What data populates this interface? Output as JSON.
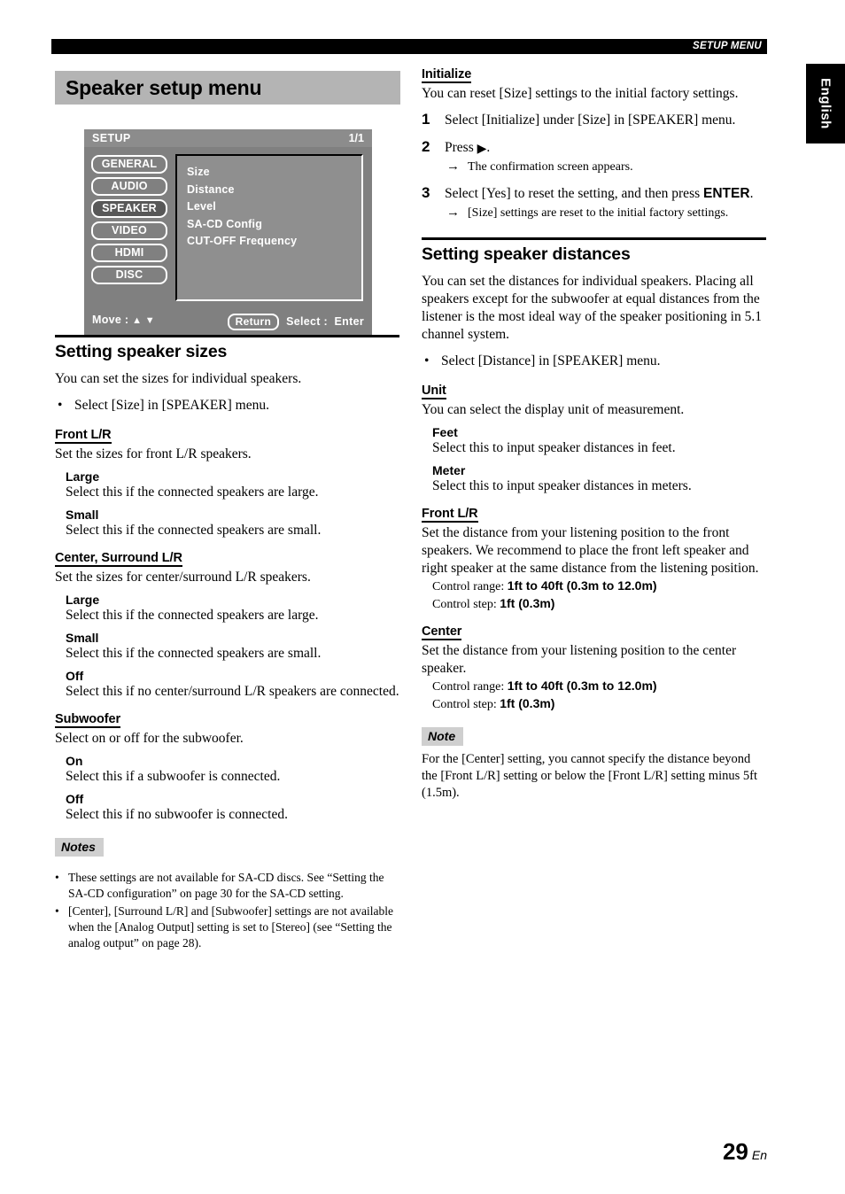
{
  "running_head": {
    "label": "SETUP MENU"
  },
  "language_tab": {
    "label": "English"
  },
  "chapter_title": "Speaker setup menu",
  "osd_screen": {
    "title": "SETUP",
    "page_indicator": "1/1",
    "tabs": [
      {
        "label": "GENERAL",
        "selected": false
      },
      {
        "label": "AUDIO",
        "selected": false
      },
      {
        "label": "SPEAKER",
        "selected": true
      },
      {
        "label": "VIDEO",
        "selected": false
      },
      {
        "label": "HDMI",
        "selected": false
      },
      {
        "label": "DISC",
        "selected": false
      }
    ],
    "items": [
      "Size",
      "Distance",
      "Level",
      "SA-CD Config",
      "CUT-OFF Frequency"
    ],
    "footer": {
      "move_label": "Move :",
      "move_arrows": "▲ ▼",
      "return_label": "Return",
      "select_label": "Select :",
      "enter_label": "Enter"
    }
  },
  "left_column": {
    "section_title": "Setting speaker sizes",
    "intro": "You can set the sizes for individual speakers.",
    "intro_bullet": "Select [Size] in [SPEAKER] menu.",
    "front_lr": {
      "heading": "Front L/R",
      "desc": "Set the sizes for front L/R speakers.",
      "options": [
        {
          "name": "Large",
          "desc": "Select this if the connected speakers are large."
        },
        {
          "name": "Small",
          "desc": "Select this if the connected speakers are small."
        }
      ]
    },
    "center_surround": {
      "heading": "Center, Surround L/R",
      "desc": "Set the sizes for center/surround L/R speakers.",
      "options": [
        {
          "name": "Large",
          "desc": "Select this if the connected speakers are large."
        },
        {
          "name": "Small",
          "desc": "Select this if the connected speakers are small."
        },
        {
          "name": "Off",
          "desc": "Select this if no center/surround L/R speakers are connected."
        }
      ]
    },
    "subwoofer": {
      "heading": "Subwoofer",
      "desc": "Select on or off for the subwoofer.",
      "options": [
        {
          "name": "On",
          "desc": "Select this if a subwoofer is connected."
        },
        {
          "name": "Off",
          "desc": "Select this if no subwoofer is connected."
        }
      ]
    },
    "notes_label": "Notes",
    "notes": [
      "These settings are not available for SA-CD discs. See “Setting the SA-CD configuration” on page 30 for the SA-CD setting.",
      "[Center], [Surround L/R] and [Subwoofer] settings are not available when the [Analog Output] setting is set to [Stereo] (see “Setting the analog output” on page 28)."
    ]
  },
  "right_column": {
    "initialize": {
      "heading": "Initialize",
      "desc": "You can reset [Size] settings to the initial factory settings.",
      "steps": [
        {
          "num": "1",
          "text": "Select [Initialize] under [Size] in [SPEAKER] menu.",
          "result": null
        },
        {
          "num": "2",
          "text_before": "Press ",
          "text_after": ".",
          "glyph": "▶",
          "result": "The confirmation screen appears."
        },
        {
          "num": "3",
          "text_before": "Select [Yes] to reset the setting, and then press ",
          "emphasis": "ENTER",
          "text_after": ".",
          "result": "[Size] settings are reset to the initial factory settings."
        }
      ]
    },
    "section_title": "Setting speaker distances",
    "intro": "You can set the distances for individual speakers. Placing all speakers except for the subwoofer at equal distances from the listener is the most ideal way of the speaker positioning in 5.1 channel system.",
    "intro_bullet": "Select [Distance] in [SPEAKER] menu.",
    "unit": {
      "heading": "Unit",
      "desc": "You can select the display unit of measurement.",
      "options": [
        {
          "name": "Feet",
          "desc": "Select this to input speaker distances in feet."
        },
        {
          "name": "Meter",
          "desc": "Select this to input speaker distances in meters."
        }
      ]
    },
    "front_lr": {
      "heading": "Front L/R",
      "desc": "Set the distance from your listening position to the front speakers. We recommend to place the front left speaker and right speaker at the same distance from the listening position.",
      "control_range_label": "Control range:",
      "control_range_value": "1ft to 40ft (0.3m to 12.0m)",
      "control_step_label": "Control step:",
      "control_step_value": "1ft (0.3m)"
    },
    "center": {
      "heading": "Center",
      "desc": "Set the distance from your listening position to the center speaker.",
      "control_range_label": "Control range:",
      "control_range_value": "1ft to 40ft (0.3m to 12.0m)",
      "control_step_label": "Control step:",
      "control_step_value": "1ft (0.3m)"
    },
    "note_label": "Note",
    "note_text": "For the [Center] setting, you cannot specify the distance beyond the [Front L/R] setting or below the [Front L/R] setting minus 5ft (1.5m)."
  },
  "folio": {
    "page_number": "29",
    "language_code": "En"
  }
}
